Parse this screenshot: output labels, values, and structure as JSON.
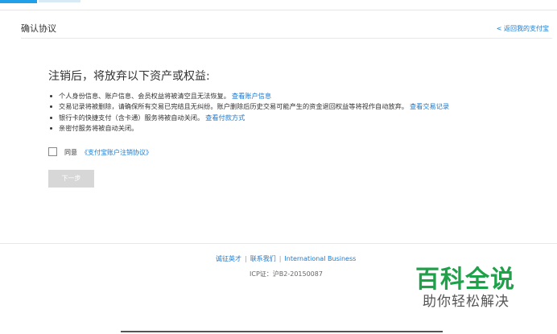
{
  "header": {
    "title": "确认协议",
    "back_link": "< 返回我的支付宝"
  },
  "main": {
    "section_title": "注销后，将放弃以下资产或权益:",
    "notes": [
      {
        "text": "个人身份信息、账户信息、会员权益将被清空且无法恢复。",
        "link": "查看账户信息"
      },
      {
        "text": "交易记录将被删除，请确保所有交易已完结且无纠纷。账户删除后历史交易可能产生的资金退回权益等将视作自动放弃。",
        "link": "查看交易记录"
      },
      {
        "text": "银行卡的快捷支付（含卡通）服务将被自动关闭。",
        "link": "查看付款方式"
      },
      {
        "text": "亲密付服务将被自动关闭。",
        "link": ""
      }
    ],
    "agree": {
      "label": "同意",
      "link": "《支付宝账户注销协议》",
      "checked": false
    },
    "next_button": "下一步"
  },
  "footer": {
    "links": [
      "诚征英才",
      "联系我们",
      "International Business"
    ],
    "icp": "ICP证：沪B2-20150087"
  },
  "watermark": {
    "title": "百科全说",
    "subtitle": "助你轻松解决",
    "color": "#1fa14a"
  },
  "colors": {
    "link": "#1a79d1",
    "button_disabled": "#d7d7d7"
  }
}
